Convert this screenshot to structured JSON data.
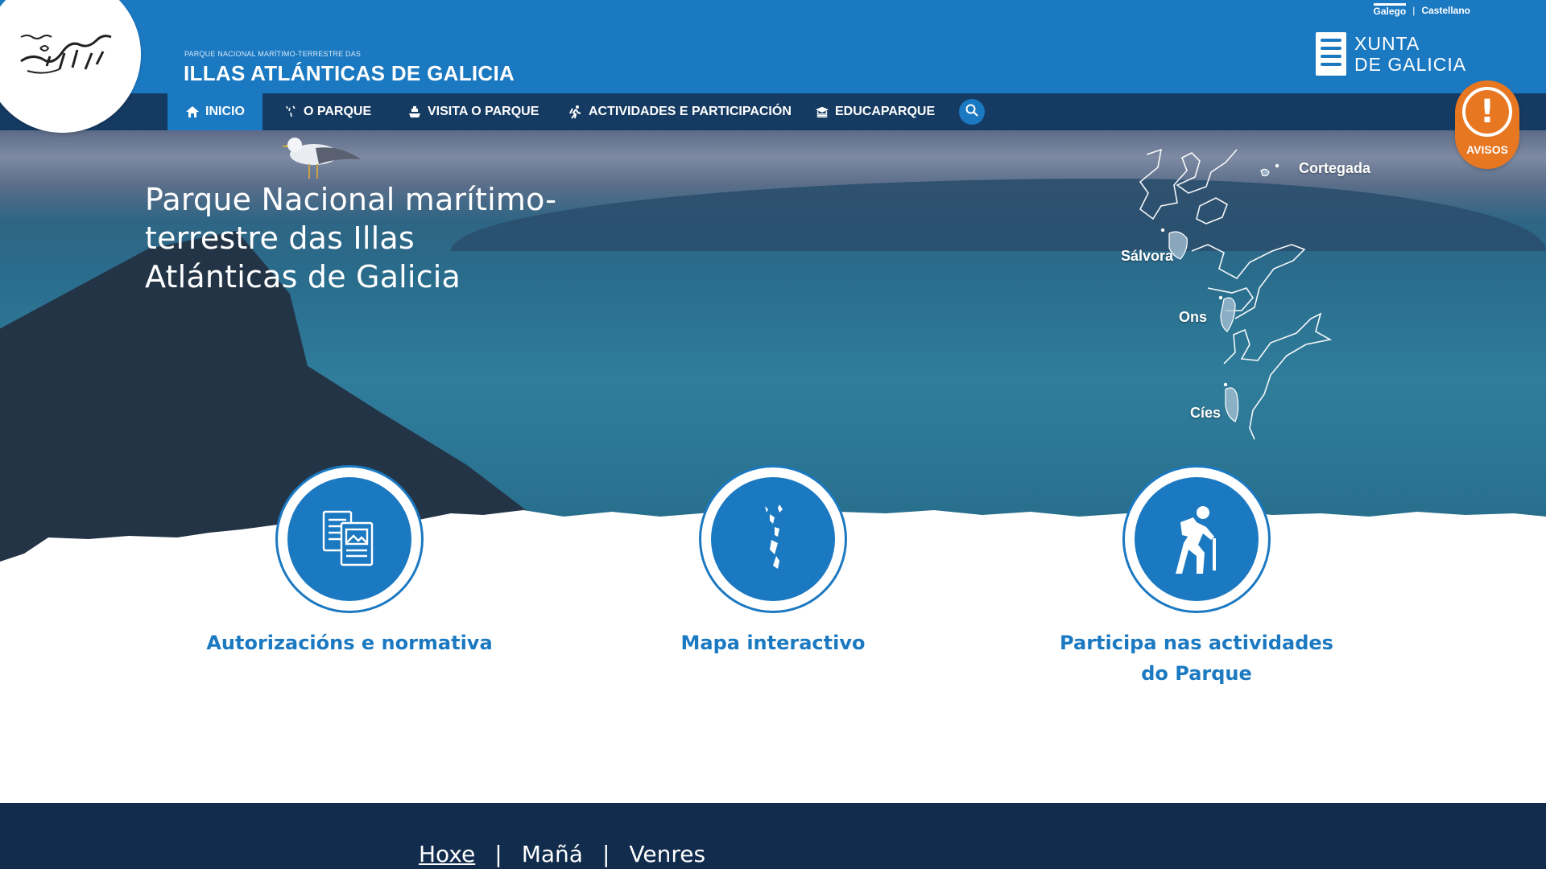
{
  "language": {
    "active": "Galego",
    "separator": "|",
    "other": "Castellano"
  },
  "site": {
    "subtitle": "PARQUE NACIONAL MARÍTIMO-TERRESTRE DAS",
    "title": "ILLAS ATLÁNTICAS DE GALICIA"
  },
  "xunta": {
    "line1": "XUNTA",
    "line2": "DE GALICIA"
  },
  "nav": {
    "items": [
      {
        "label": "INICIO",
        "icon": "home-icon"
      },
      {
        "label": "O PARQUE",
        "icon": "islands-icon"
      },
      {
        "label": "VISITA O PARQUE",
        "icon": "boat-icon"
      },
      {
        "label": "ACTIVIDADES E PARTICIPACIÓN",
        "icon": "hiker-icon"
      },
      {
        "label": "EDUCAPARQUE",
        "icon": "graduation-icon"
      }
    ],
    "search_icon": "search-icon"
  },
  "avisos": {
    "symbol": "!",
    "label": "AVISOS"
  },
  "hero": {
    "title": "Parque Nacional marítimo-terrestre das Illas Atlánticas de Galicia",
    "islands": [
      "Cortegada",
      "Sálvora",
      "Ons",
      "Cíes"
    ]
  },
  "quick_links": [
    {
      "label": "Autorizacións e normativa",
      "icon": "documents-icon"
    },
    {
      "label": "Mapa interactivo",
      "icon": "map-icon"
    },
    {
      "label": "Participa nas actividades do Parque",
      "icon": "hiker-icon"
    }
  ],
  "weather_days": {
    "today": "Hoxe",
    "sep1": "|",
    "tomorrow": "Mañá",
    "sep2": "|",
    "next": "Venres"
  },
  "colors": {
    "primary": "#1b79c2",
    "nav_dark": "#153b63",
    "footer": "#122c4d",
    "warning": "#e87722"
  }
}
